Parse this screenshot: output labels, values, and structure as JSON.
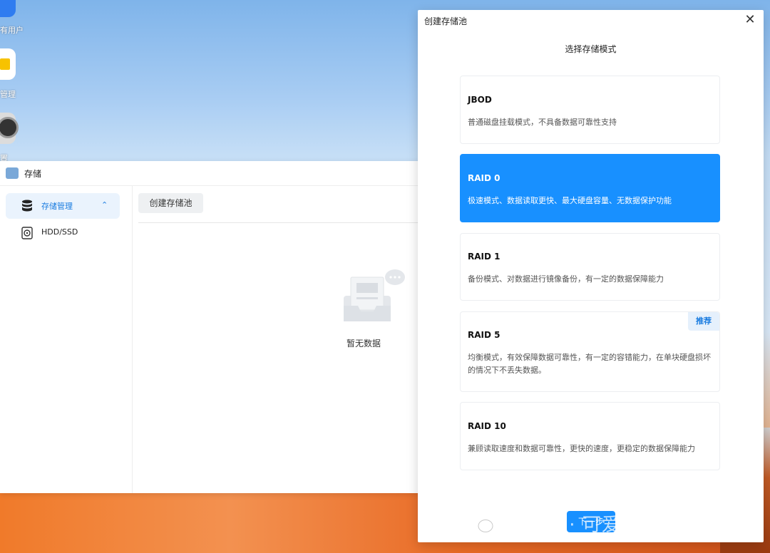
{
  "desktop": {
    "icons": [
      {
        "label": "有用户",
        "icon": "user-icon"
      },
      {
        "label": "管理",
        "icon": "folder-icon"
      },
      {
        "label": "置",
        "icon": "settings-icon"
      }
    ]
  },
  "storage_window": {
    "title": "存储",
    "sidebar": {
      "items": [
        {
          "label": "存储管理",
          "icon": "database-icon",
          "active": true
        },
        {
          "label": "HDD/SSD",
          "icon": "disk-icon",
          "active": false
        }
      ]
    },
    "toolbar": {
      "create_label": "创建存储池"
    },
    "empty_text": "暂无数据"
  },
  "modal": {
    "title": "创建存储池",
    "subtitle": "选择存储模式",
    "options": [
      {
        "name": "JBOD",
        "desc": "普通磁盘挂载模式，不具备数据可靠性支持",
        "selected": false
      },
      {
        "name": "RAID 0",
        "desc": "极速模式、数据读取更快、最大硬盘容量、无数据保护功能",
        "selected": true
      },
      {
        "name": "RAID 1",
        "desc": "备份模式、对数据进行镜像备份，有一定的数据保障能力",
        "selected": false
      },
      {
        "name": "RAID 5",
        "desc": "均衡模式，有效保障数据可靠性，有一定的容错能力，在单块硬盘损坏的情况下不丢失数据。",
        "selected": false,
        "badge": "推荐"
      },
      {
        "name": "RAID 10",
        "desc": "兼顾读取速度和数据可靠性，更快的速度，更稳定的数据保障能力",
        "selected": false
      }
    ],
    "next_label": "下一步"
  },
  "watermark": "公众号 · 可爱的小Cherry",
  "colors": {
    "accent": "#1890ff",
    "selected_bg": "#1890ff",
    "badge_bg": "#e5f0fc"
  }
}
